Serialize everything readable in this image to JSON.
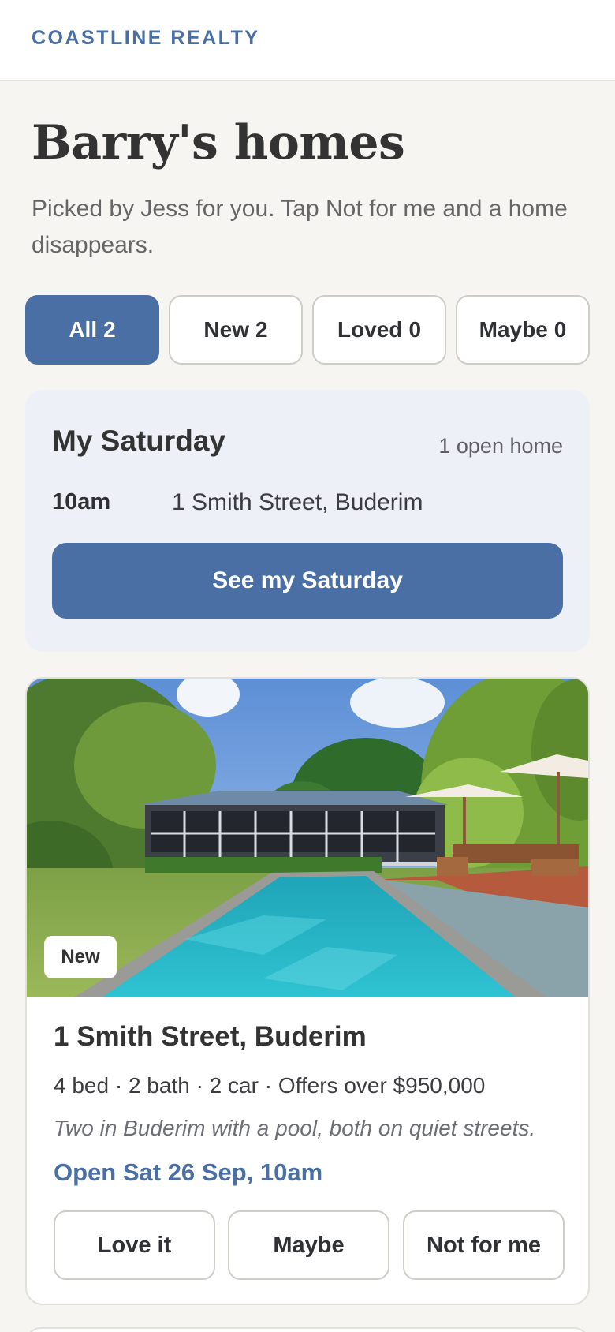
{
  "brand": "COASTLINE REALTY",
  "page": {
    "title": "Barry's homes",
    "subtitle": "Picked by Jess for you. Tap Not for me and a home disappears."
  },
  "filters": [
    {
      "label": "All",
      "count": "2",
      "active": true
    },
    {
      "label": "New",
      "count": "2",
      "active": false
    },
    {
      "label": "Loved",
      "count": "0",
      "active": false
    },
    {
      "label": "Maybe",
      "count": "0",
      "active": false
    }
  ],
  "saturday": {
    "title": "My Saturday",
    "count": "1 open home",
    "time": "10am",
    "address": "1 Smith Street, Buderim",
    "button": "See my Saturday"
  },
  "listing": {
    "photo_icon": "property-photo-pool-house",
    "badge": "New",
    "title": "1 Smith Street, Buderim",
    "specs": "4 bed · 2 bath · 2 car · Offers over $950,000",
    "note": "Two in Buderim with a pool, both on quiet streets.",
    "open": "Open Sat 26 Sep, 10am",
    "actions": {
      "love": "Love it",
      "maybe": "Maybe",
      "not": "Not for me"
    }
  },
  "colors": {
    "accent": "#4a6fa5",
    "background": "#f6f5f2",
    "panel": "#edf1f7"
  }
}
